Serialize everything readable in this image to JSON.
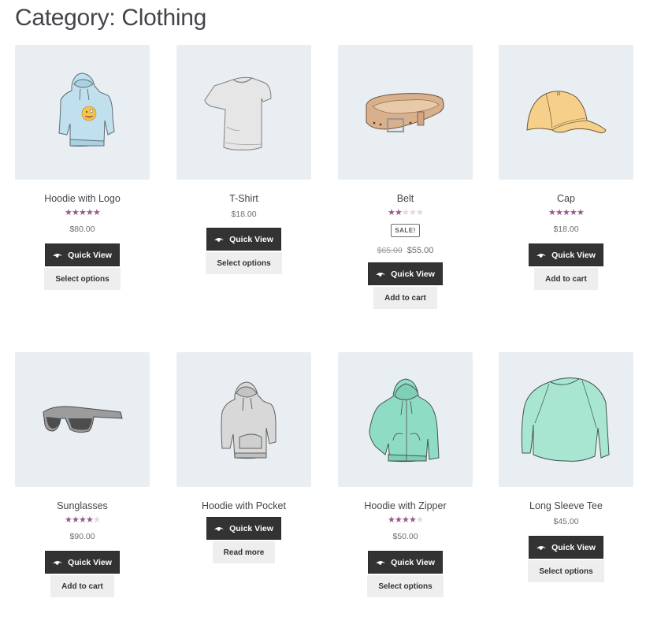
{
  "page": {
    "title": "Category: Clothing"
  },
  "colors": {
    "star_filled": "#96588a",
    "star_empty": "#e7d3e2",
    "quick_view_bg": "#333333",
    "secondary_button_bg": "#eeeeee",
    "thumbnail_bg": "#e9eef3"
  },
  "quick_view_label": "Quick View",
  "products": [
    {
      "name": "Hoodie with Logo",
      "image": "hoodie-with-logo-illustration",
      "rating": 5,
      "rating_max": 5,
      "on_sale": false,
      "regular_price": "$80.00",
      "action_label": "Select options"
    },
    {
      "name": "T-Shirt",
      "image": "t-shirt-illustration",
      "rating": 0,
      "rating_max": 5,
      "on_sale": false,
      "regular_price": "$18.00",
      "action_label": "Select options"
    },
    {
      "name": "Belt",
      "image": "belt-illustration",
      "rating": 2,
      "rating_max": 5,
      "on_sale": true,
      "sale_badge": "SALE!",
      "regular_price": "$65.00",
      "sale_price": "$55.00",
      "action_label": "Add to cart"
    },
    {
      "name": "Cap",
      "image": "cap-illustration",
      "rating": 5,
      "rating_max": 5,
      "on_sale": false,
      "regular_price": "$18.00",
      "action_label": "Add to cart"
    },
    {
      "name": "Sunglasses",
      "image": "sunglasses-illustration",
      "rating": 4,
      "rating_max": 5,
      "on_sale": false,
      "regular_price": "$90.00",
      "action_label": "Add to cart"
    },
    {
      "name": "Hoodie with Pocket",
      "image": "hoodie-with-pocket-illustration",
      "rating": 0,
      "rating_max": 5,
      "on_sale": false,
      "regular_price": "",
      "action_label": "Read more"
    },
    {
      "name": "Hoodie with Zipper",
      "image": "hoodie-with-zipper-illustration",
      "rating": 4,
      "rating_max": 5,
      "on_sale": false,
      "regular_price": "$50.00",
      "action_label": "Select options"
    },
    {
      "name": "Long Sleeve Tee",
      "image": "long-sleeve-tee-illustration",
      "rating": 0,
      "rating_max": 5,
      "on_sale": false,
      "regular_price": "$45.00",
      "action_label": "Select options"
    }
  ]
}
